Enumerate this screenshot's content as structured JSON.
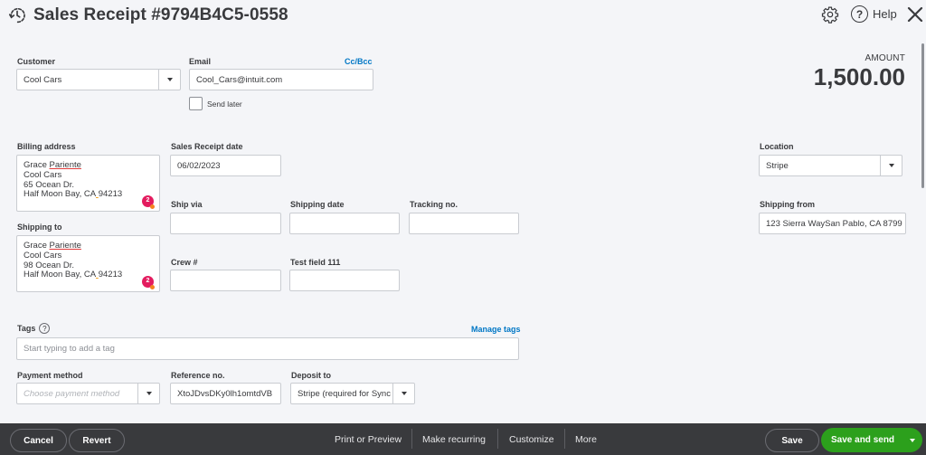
{
  "header": {
    "title": "Sales Receipt #9794B4C5-0558",
    "help_label": "Help",
    "icons": [
      "recent-history-icon",
      "gear-icon",
      "help-icon",
      "close-icon"
    ]
  },
  "amount": {
    "label": "AMOUNT",
    "value": "1,500.00"
  },
  "customer": {
    "label": "Customer",
    "value": "Cool Cars"
  },
  "email": {
    "label": "Email",
    "value": "Cool_Cars@intuit.com",
    "cc_bcc_label": "Cc/Bcc",
    "send_later_label": "Send later",
    "send_later_checked": false
  },
  "billing_address": {
    "label": "Billing address",
    "lines": [
      "Grace Pariente",
      "Cool Cars",
      "65 Ocean Dr.",
      "Half Moon Bay, CA 94213"
    ],
    "name_first": "Grace ",
    "name_last": "Pariente",
    "city_state": "Half Moon Bay, CA",
    "zip": "94213",
    "badge_count": "2"
  },
  "shipping_to": {
    "label": "Shipping to",
    "lines": [
      "Grace Pariente",
      "Cool Cars",
      "98 Ocean Dr.",
      "Half Moon Bay, CA 94213"
    ],
    "name_first": "Grace ",
    "name_last": "Pariente",
    "city_state": "Half Moon Bay, CA",
    "zip": "94213",
    "badge_count": "2"
  },
  "sales_receipt_date": {
    "label": "Sales Receipt date",
    "value": "06/02/2023"
  },
  "ship_via": {
    "label": "Ship via",
    "value": ""
  },
  "shipping_date": {
    "label": "Shipping date",
    "value": ""
  },
  "tracking_no": {
    "label": "Tracking no.",
    "value": ""
  },
  "crew": {
    "label": "Crew #",
    "value": ""
  },
  "test_field": {
    "label": "Test field 111",
    "value": ""
  },
  "location": {
    "label": "Location",
    "value": "Stripe"
  },
  "shipping_from": {
    "label": "Shipping from",
    "value": "123 Sierra WaySan Pablo, CA  8799"
  },
  "tags": {
    "label": "Tags",
    "manage_label": "Manage tags",
    "placeholder": "Start typing to add a tag"
  },
  "payment_method": {
    "label": "Payment method",
    "placeholder": "Choose payment method"
  },
  "reference_no": {
    "label": "Reference no.",
    "value": "XtoJDvsDKy0lh1omtdVB"
  },
  "deposit_to": {
    "label": "Deposit to",
    "value": "Stripe (required for Sync"
  },
  "footer": {
    "cancel_label": "Cancel",
    "revert_label": "Revert",
    "print_label": "Print or Preview",
    "recurring_label": "Make recurring",
    "customize_label": "Customize",
    "more_label": "More",
    "save_label": "Save",
    "save_send_label": "Save and send"
  },
  "colors": {
    "primary_green": "#2ca01c",
    "link_blue": "#0077c5",
    "footer_bg": "#393a3d",
    "badge_red": "#e31c5f",
    "badge_dot_orange": "#f58220"
  }
}
